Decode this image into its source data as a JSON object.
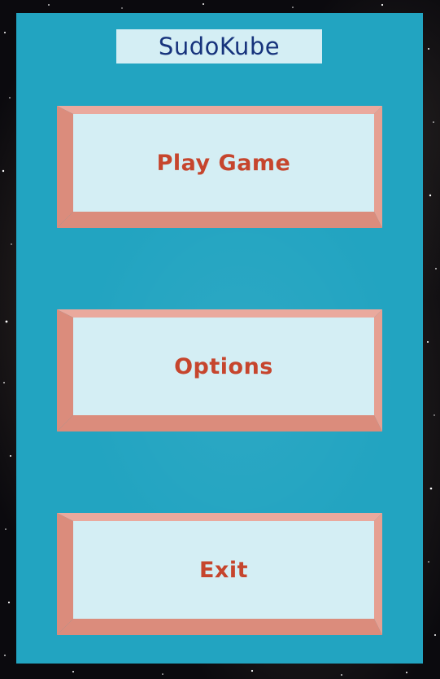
{
  "game": {
    "title": "SudoKube"
  },
  "menu": {
    "buttons": [
      {
        "label": "Play Game"
      },
      {
        "label": "Options"
      },
      {
        "label": "Exit"
      }
    ]
  },
  "colors": {
    "panel": "#22a4c1",
    "button_face": "#d4eef4",
    "button_bevel_top": "#eaa99d",
    "button_bevel_side": "#db8c7c",
    "button_label": "#c6452d",
    "title_text": "#17337c"
  }
}
